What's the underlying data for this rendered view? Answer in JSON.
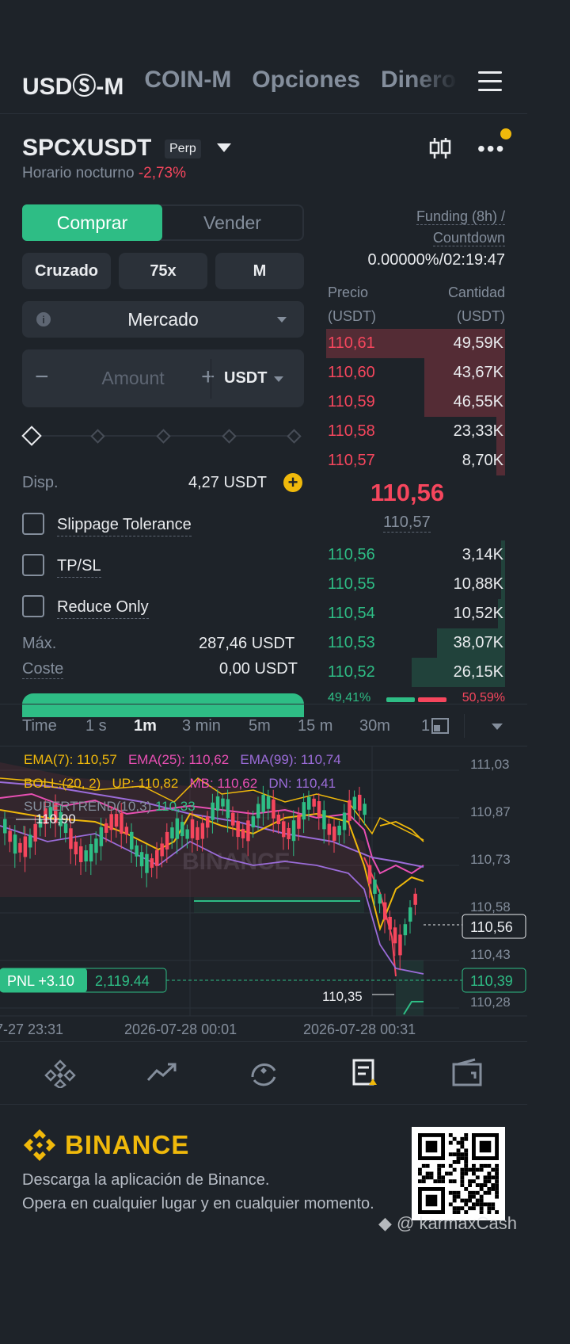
{
  "tabs": [
    {
      "label": "USDⓈ-M",
      "active": true
    },
    {
      "label": "COIN-M",
      "active": false
    },
    {
      "label": "Opciones",
      "active": false
    },
    {
      "label": "Dinero",
      "active": false
    }
  ],
  "symbol": {
    "name": "SPCXUSDT",
    "badge": "Perp",
    "session": "Horario nocturno",
    "change": "-2,73%"
  },
  "order_form": {
    "buy_label": "Comprar",
    "sell_label": "Vender",
    "margin_mode": "Cruzado",
    "leverage": "75x",
    "asset_mode": "M",
    "order_type": "Mercado",
    "amount_placeholder": "Amount",
    "amount_minus": "−",
    "amount_plus": "+",
    "amount_unit": "USDT",
    "available_label": "Disp.",
    "available_value": "4,27 USDT",
    "options": [
      "Slippage Tolerance",
      "TP/SL",
      "Reduce Only"
    ],
    "max_label": "Máx.",
    "max_value": "287,46 USDT",
    "cost_label": "Coste",
    "cost_value": "0,00 USDT"
  },
  "orderbook": {
    "funding_label_1": "Funding (8h) /",
    "funding_label_2": "Countdown",
    "funding_value": "0.00000%/02:19:47",
    "price_header_1": "Precio",
    "price_header_2": "(USDT)",
    "qty_header_1": "Cantidad",
    "qty_header_2": "(USDT)",
    "asks": [
      {
        "price": "110,61",
        "qty": "49,59K",
        "depth": 1.0
      },
      {
        "price": "110,60",
        "qty": "43,67K",
        "depth": 0.45
      },
      {
        "price": "110,59",
        "qty": "46,55K",
        "depth": 0.45
      },
      {
        "price": "110,58",
        "qty": "23,33K",
        "depth": 0.05
      },
      {
        "price": "110,57",
        "qty": "8,70K",
        "depth": 0.05
      }
    ],
    "last_price": "110,56",
    "mark_price": "110,57",
    "bids": [
      {
        "price": "110,56",
        "qty": "3,14K",
        "depth": 0.02
      },
      {
        "price": "110,55",
        "qty": "10,88K",
        "depth": 0.02
      },
      {
        "price": "110,54",
        "qty": "10,52K",
        "depth": 0.04
      },
      {
        "price": "110,53",
        "qty": "38,07K",
        "depth": 0.38
      },
      {
        "price": "110,52",
        "qty": "26,15K",
        "depth": 0.52
      }
    ],
    "buy_ratio": "49,41%",
    "sell_ratio": "50,59%"
  },
  "timeframes": [
    {
      "label": "Time",
      "active": false
    },
    {
      "label": "1 s",
      "active": false
    },
    {
      "label": "1m",
      "active": true
    },
    {
      "label": "3 min",
      "active": false
    },
    {
      "label": "5m",
      "active": false
    },
    {
      "label": "15 m",
      "active": false
    },
    {
      "label": "30m",
      "active": false
    },
    {
      "label": "1",
      "active": false
    }
  ],
  "chart": {
    "ema7": "EMA(7): 110,57",
    "ema25": "EMA(25): 110,62",
    "ema99": "EMA(99): 110,74",
    "boll": "BOLL:(20, 2)",
    "up": "UP: 110,82",
    "mb": "MB: 110,62",
    "dn": "DN: 110,41",
    "supertrend_label": "SUPERTREND(10,3)",
    "supertrend_value": "110,33",
    "y_ticks": [
      "111,03",
      "110,87",
      "110,73",
      "110,58",
      "110,43",
      "110,28"
    ],
    "x_ticks": [
      "7-27 23:31",
      "2026-07-28 00:01",
      "2026-07-28 00:31"
    ],
    "high_label": "110,90",
    "low_label": "110,35",
    "last_price": "110,56",
    "pnl_label": "PNL +3.10",
    "pnl_value": "2,119.44",
    "entry_price": "110,39",
    "watermark": "BINANCE",
    "colors": {
      "up": "#2ebd85",
      "down": "#f6465d",
      "ema7": "#f0b90b",
      "ema25": "#e84fb3",
      "ema99": "#9b6cd9"
    }
  },
  "bottom_nav": [
    {
      "icon": "home-icon"
    },
    {
      "icon": "markets-icon"
    },
    {
      "icon": "trade-icon"
    },
    {
      "icon": "futures-icon",
      "active": true
    },
    {
      "icon": "wallet-icon"
    }
  ],
  "footer": {
    "brand": "BINANCE",
    "tagline_1": "Descarga la aplicación de Binance.",
    "tagline_2": "Opera en cualquier lugar y en cualquier momento.",
    "watermark": "@ karmaxCash"
  }
}
